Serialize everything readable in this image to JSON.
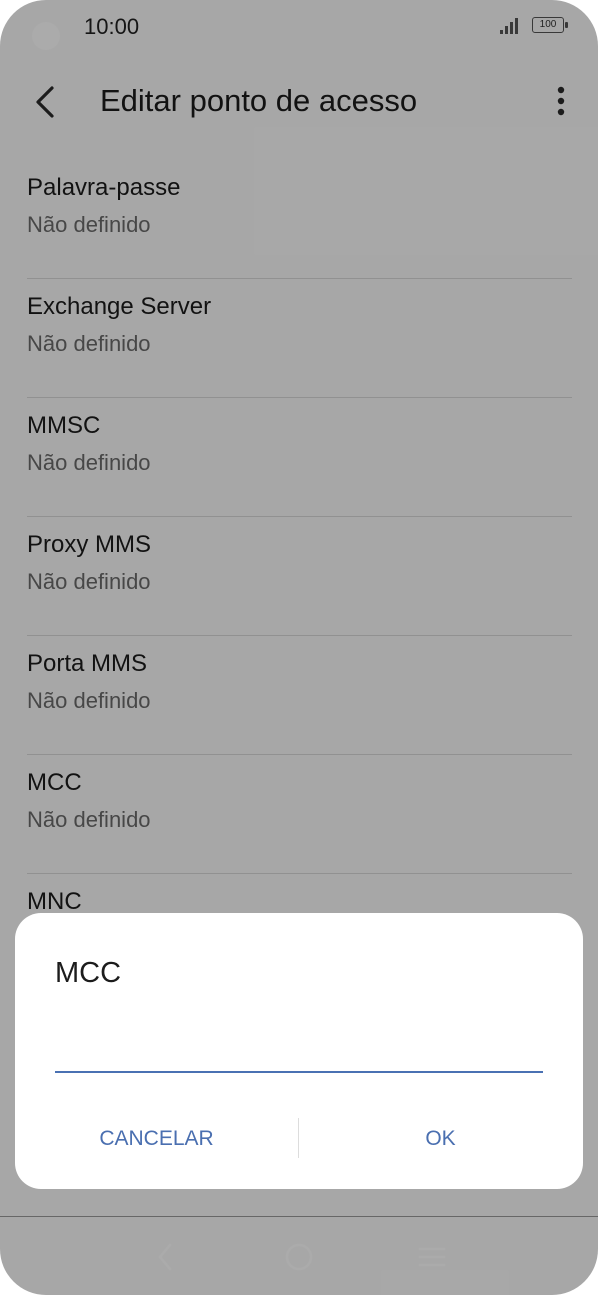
{
  "status_bar": {
    "time": "10:00",
    "battery": "100"
  },
  "app_bar": {
    "title": "Editar ponto de acesso"
  },
  "list": {
    "items": [
      {
        "label": "Palavra-passe",
        "value": "Não definido"
      },
      {
        "label": "Exchange Server",
        "value": "Não definido"
      },
      {
        "label": "MMSC",
        "value": "Não definido"
      },
      {
        "label": "Proxy MMS",
        "value": "Não definido"
      },
      {
        "label": "Porta MMS",
        "value": "Não definido"
      },
      {
        "label": "MCC",
        "value": "Não definido"
      },
      {
        "label": "MNC",
        "value": ""
      }
    ]
  },
  "dialog": {
    "title": "MCC",
    "input_value": "",
    "cancel_label": "CANCELAR",
    "ok_label": "OK"
  },
  "icons": {
    "back": "chevron-left-icon",
    "more": "more-vertical-icon",
    "nav_back": "nav-back-icon",
    "nav_home": "nav-home-icon",
    "nav_recents": "nav-recents-icon"
  },
  "colors": {
    "accent": "#4a6fb0"
  }
}
